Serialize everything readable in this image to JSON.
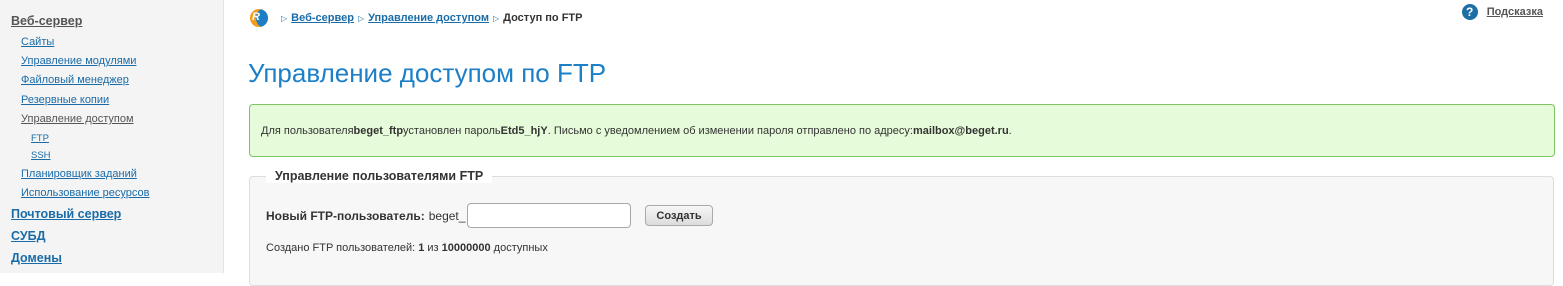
{
  "sidebar": {
    "sections": [
      {
        "label": "Веб-сервер",
        "current": true
      },
      {
        "label": "Почтовый сервер"
      },
      {
        "label": "СУБД"
      },
      {
        "label": "Домены"
      }
    ],
    "web_items": [
      "Сайты",
      "Управление модулями",
      "Файловый менеджер",
      "Резервные копии",
      "Управление доступом"
    ],
    "access_sub": [
      "FTP",
      "SSH"
    ],
    "web_items_after": [
      "Планировщик заданий",
      "Использование ресурсов"
    ]
  },
  "breadcrumb": {
    "logo_text": "R",
    "items": [
      "Веб-сервер",
      "Управление доступом"
    ],
    "current": "Доступ по FTP",
    "separator": "▷"
  },
  "help": {
    "icon": "?",
    "label": "Подсказка"
  },
  "page_title": "Управление доступом по FTP",
  "notice": {
    "t1": "Для пользователя ",
    "user": "beget_ftp",
    "t2": " установлен пароль ",
    "password": "Etd5_hjY",
    "t3": ". Письмо с уведомлением об изменении пароля отправлено по адресу: ",
    "email": "mailbox@beget.ru",
    "t4": "."
  },
  "ftp_panel": {
    "title": "Управление пользователями FTP",
    "new_label": "Новый FTP-пользователь:",
    "prefix": "beget_",
    "input_value": "",
    "create_label": "Создать",
    "count_t1": "Создано FTP пользователей: ",
    "count_created": "1",
    "count_t2": " из ",
    "count_total": "10000000",
    "count_t3": " доступных"
  },
  "colors": {
    "accent": "#1d7fc6",
    "notice_bg": "#e6fbd9",
    "notice_border": "#7cc663"
  }
}
